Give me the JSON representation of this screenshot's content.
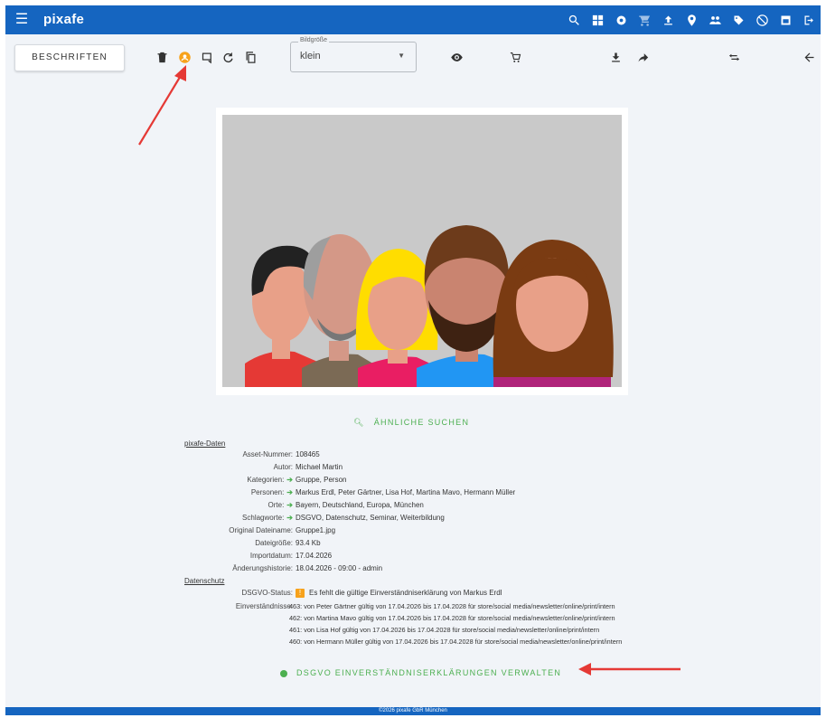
{
  "app": {
    "brand": "pixafe"
  },
  "topbar": {
    "icons": [
      "search-icon",
      "grid-icon",
      "settings-icon",
      "cart-icon",
      "upload-icon",
      "location-icon",
      "people-icon",
      "tag-icon",
      "block-icon",
      "calendar-icon",
      "logout-icon"
    ]
  },
  "toolbar": {
    "label_button": "BESCHRIFTEN",
    "select": {
      "legend": "Bildgröße",
      "value": "klein"
    }
  },
  "similar_search": "ÄHNLICHE SUCHEN",
  "info": {
    "section_pixafe": "pixafe-Daten",
    "section_privacy": "Datenschutz",
    "rows": [
      {
        "label": "Asset-Nummer:",
        "value": "108465"
      },
      {
        "label": "Autor:",
        "value": "Michael Martin"
      },
      {
        "label": "Kategorien:",
        "value": "Gruppe, Person"
      },
      {
        "label": "Personen:",
        "value": "Markus Erdl, Peter Gärtner, Lisa Hof, Martina Mavo, Hermann Müller"
      },
      {
        "label": "Orte:",
        "value": "Bayern, Deutschland, Europa, München"
      },
      {
        "label": "Schlagworte:",
        "value": "DSGVO, Datenschutz, Seminar, Weiterbildung"
      },
      {
        "label": "Original Dateiname:",
        "value": "Gruppe1.jpg"
      },
      {
        "label": "Dateigröße:",
        "value": "93.4 Kb"
      },
      {
        "label": "Importdatum:",
        "value": "17.04.2026"
      },
      {
        "label": "Änderungshistorie:",
        "value": "18.04.2026 - 09:00 - admin"
      }
    ],
    "privacy": {
      "status_label": "DSGVO-Status:",
      "status_value": "Es fehlt die gültige Einverständniserklärung von Markus Erdl",
      "consent_label": "Einverständnisse:",
      "consents": [
        "463: von Peter Gärtner gültig von 17.04.2026 bis 17.04.2028 für store/social media/newsletter/online/print/intern",
        "462: von Martina Mavo gültig von 17.04.2026 bis 17.04.2028 für store/social media/newsletter/online/print/intern",
        "461: von Lisa Hof gültig von 17.04.2026 bis 17.04.2028 für store/social media/newsletter/online/print/intern",
        "460: von Hermann Müller gültig von 17.04.2026 bis 17.04.2028 für store/social media/newsletter/online/print/intern"
      ]
    }
  },
  "manage_button": "DSGVO EINVERSTÄNDNISERKLÄRUNGEN VERWALTEN",
  "footer": "©2026 pixafe GbR München",
  "colors": {
    "primary": "#1565c0",
    "accent_green": "#4caf50",
    "highlight_orange": "#f7a21b",
    "annotation_red": "#e53935"
  }
}
